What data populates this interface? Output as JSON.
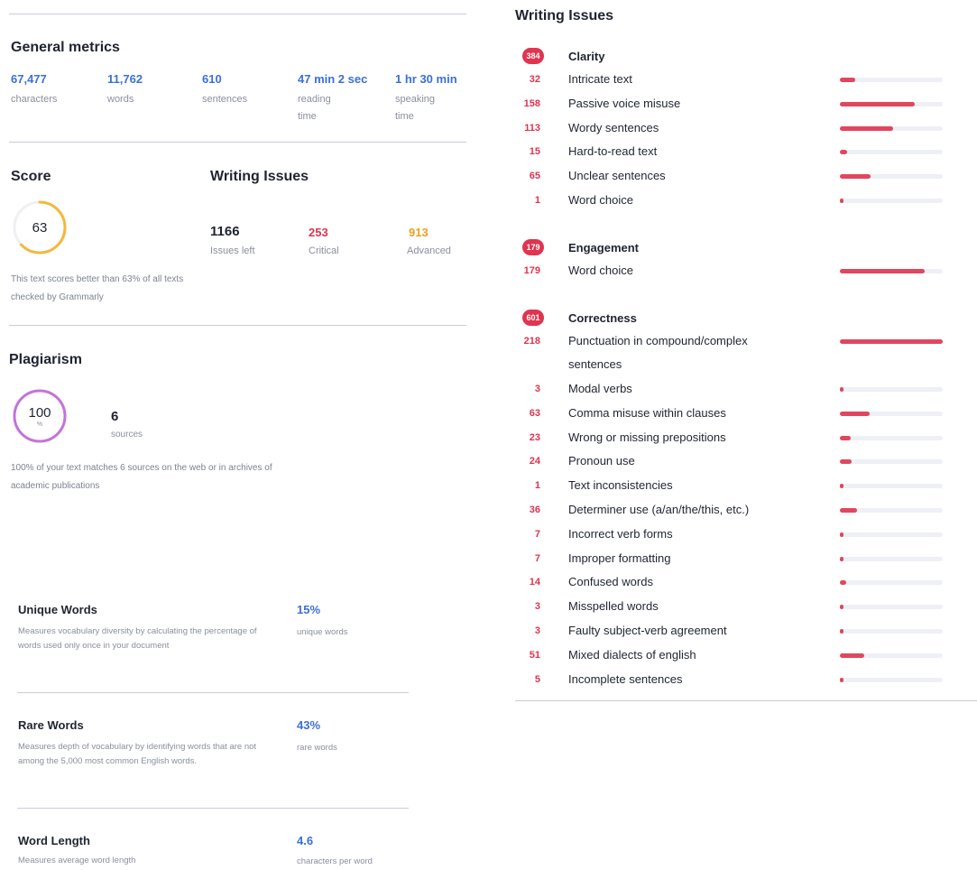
{
  "general_metrics": {
    "title": "General metrics",
    "items": [
      {
        "value": "67,477",
        "label": "characters"
      },
      {
        "value": "11,762",
        "label": "words"
      },
      {
        "value": "610",
        "label": "sentences"
      },
      {
        "value": "47 min 2 sec",
        "label": "reading time"
      },
      {
        "value": "1 hr 30 min",
        "label": "speaking time"
      }
    ]
  },
  "score": {
    "title": "Score",
    "value": "63",
    "fraction": 0.63,
    "ring_color": "#f5b83d",
    "description": "This text scores better than 63% of all texts checked by Grammarly"
  },
  "writing_issues_summary": {
    "title": "Writing Issues",
    "items": [
      {
        "value": "1166",
        "label": "Issues left",
        "color": "#1f2430"
      },
      {
        "value": "253",
        "label": "Critical",
        "color": "#e0344f"
      },
      {
        "value": "913",
        "label": "Advanced",
        "color": "#f0a020"
      }
    ]
  },
  "plagiarism": {
    "title": "Plagiarism",
    "value": "100",
    "unit": "%",
    "ring_color": "#c274d9",
    "sources_count": "6",
    "sources_label": "sources",
    "description": "100% of your text matches 6 sources on the web or in archives of academic publications"
  },
  "extra_metrics": [
    {
      "title": "Unique Words",
      "description": "Measures vocabulary diversity by calculating the percentage of words used only once in your document",
      "value": "15%",
      "unit": "unique words"
    },
    {
      "title": "Rare Words",
      "description": "Measures depth of vocabulary by identifying words that are not among the 5,000 most common English words.",
      "value": "43%",
      "unit": "rare words"
    },
    {
      "title": "Word Length",
      "description": "Measures average word length",
      "value": "4.6",
      "unit": "characters per word"
    }
  ],
  "writing_issues": {
    "title": "Writing Issues",
    "max_count": 218,
    "categories": [
      {
        "badge": "384",
        "title": "Clarity",
        "rows": [
          {
            "count": "32",
            "label": "Intricate text",
            "n": 32
          },
          {
            "count": "158",
            "label": "Passive voice misuse",
            "n": 158
          },
          {
            "count": "113",
            "label": "Wordy sentences",
            "n": 113
          },
          {
            "count": "15",
            "label": "Hard-to-read text",
            "n": 15
          },
          {
            "count": "65",
            "label": "Unclear sentences",
            "n": 65
          },
          {
            "count": "1",
            "label": "Word choice",
            "n": 1
          }
        ]
      },
      {
        "badge": "179",
        "title": "Engagement",
        "rows": [
          {
            "count": "179",
            "label": "Word choice",
            "n": 179
          }
        ]
      },
      {
        "badge": "601",
        "title": "Correctness",
        "rows": [
          {
            "count": "218",
            "label": "Punctuation in compound/complex sentences",
            "n": 218
          },
          {
            "count": "3",
            "label": "Modal verbs",
            "n": 3
          },
          {
            "count": "63",
            "label": "Comma misuse within clauses",
            "n": 63
          },
          {
            "count": "23",
            "label": "Wrong or missing prepositions",
            "n": 23
          },
          {
            "count": "24",
            "label": "Pronoun use",
            "n": 24
          },
          {
            "count": "1",
            "label": "Text inconsistencies",
            "n": 1
          },
          {
            "count": "36",
            "label": "Determiner use (a/an/the/this, etc.)",
            "n": 36
          },
          {
            "count": "7",
            "label": "Incorrect verb forms",
            "n": 7
          },
          {
            "count": "7",
            "label": "Improper formatting",
            "n": 7
          },
          {
            "count": "14",
            "label": "Confused words",
            "n": 14
          },
          {
            "count": "3",
            "label": "Misspelled words",
            "n": 3
          },
          {
            "count": "3",
            "label": "Faulty subject-verb agreement",
            "n": 3
          },
          {
            "count": "51",
            "label": "Mixed dialects of english",
            "n": 51
          },
          {
            "count": "5",
            "label": "Incomplete sentences",
            "n": 5
          }
        ]
      }
    ]
  }
}
